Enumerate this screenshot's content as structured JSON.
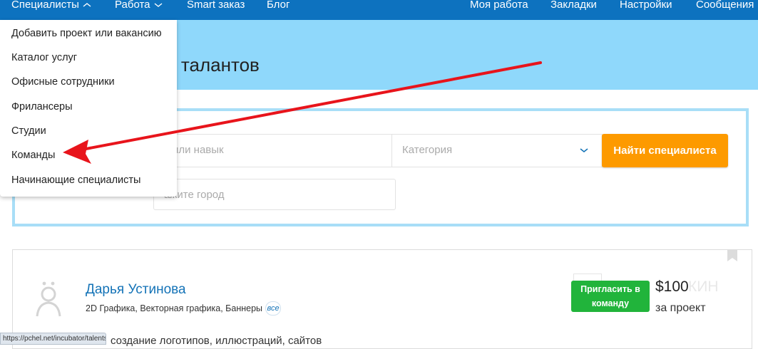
{
  "nav": {
    "specialists": "Специалисты",
    "work": "Работа",
    "smart_order": "Smart заказ",
    "blog": "Блог",
    "my_work": "Моя работа",
    "bookmarks": "Закладки",
    "settings": "Настройки",
    "messages": "Сообщения"
  },
  "hero": {
    "title_visible": "ых талантов"
  },
  "search": {
    "skill_placeholder": "ь или навык",
    "category_placeholder": "Категория",
    "city_placeholder": "ажите город",
    "find_button": "Найти специалиста"
  },
  "dropdown": {
    "items": [
      "Добавить проект или вакансию",
      "Каталог услуг",
      "Офисные сотрудники",
      "Фрилансеры",
      "Студии",
      "Команды",
      "Начинающие специалисты"
    ]
  },
  "card": {
    "name": "Дарья Устинова",
    "skills": "2D Графика, Векторная графика, Баннеры",
    "all_badge": "все",
    "description": "создание логотипов, иллюстраций, сайтов",
    "invite_line1": "Пригласить в",
    "invite_line2": "команду",
    "price": "$100",
    "price_ghost": "КИН",
    "price_unit": "за проект"
  },
  "statusbar": {
    "url": "https://pchel.net/incubator/talents/#"
  },
  "colors": {
    "nav_bg": "#0d72bf",
    "hero_bg": "#8fd8fb",
    "frame_border": "#a8def7",
    "find_button": "#fd9a00",
    "invite_button": "#21b43b",
    "link": "#1473b7",
    "annotation_arrow": "#e8141b"
  }
}
